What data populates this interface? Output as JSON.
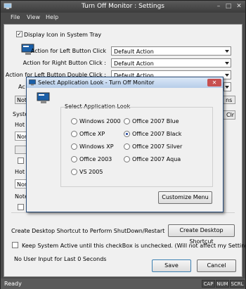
{
  "window": {
    "title": "Turn Off Monitor : Settings"
  },
  "menu": {
    "items": [
      "File",
      "View",
      "Help"
    ]
  },
  "settings": {
    "display_tray_label": "Display Icon in System Tray",
    "display_tray_checked": true,
    "left_click_label": "Action for Left Button Click",
    "left_click_value": "Default Action",
    "right_click_label": "Action for Right Button Click :",
    "right_click_value": "Default Action",
    "left_dbl_label": "Action for Left Button Double Click :",
    "left_dbl_value": "Default Action",
    "partial_act": "Ac",
    "partial_note1": "Note",
    "partial_syste": "Syste",
    "partial_hot1": "Hot k",
    "partial_none1": "Non",
    "partial_hot2": "Hot k",
    "partial_none2": "Non",
    "partial_note2": "Note",
    "partial_ns": "ns",
    "partial_clr": "Clr",
    "shortcut_label": "Create Desktop Shortcut to Perform ShutDown/Restart",
    "shortcut_button": "Create Desktop Shortcut",
    "keep_active_label": "Keep System Active until this checkBox is unchecked.  (Will not affect my Settings)",
    "keep_active_checked": false,
    "no_input_label": "No User Input for Last 0 Seconds",
    "save_button": "Save",
    "cancel_button": "Cancel"
  },
  "statusbar": {
    "text": "Ready",
    "indicators": [
      "CAP",
      "NUM",
      "SCRL"
    ]
  },
  "dialog": {
    "title": "Select Application Look - Turn Off Monitor",
    "close_label": "✕",
    "group_label": "Select Application Look",
    "options": [
      {
        "label": "Windows 2000",
        "selected": false
      },
      {
        "label": "Office 2007 Blue",
        "selected": false
      },
      {
        "label": "Office XP",
        "selected": false
      },
      {
        "label": "Office 2007 Black",
        "selected": true
      },
      {
        "label": "Windows XP",
        "selected": false
      },
      {
        "label": "Office 2007 Silver",
        "selected": false
      },
      {
        "label": "Office 2003",
        "selected": false
      },
      {
        "label": "Office 2007 Aqua",
        "selected": false
      },
      {
        "label": "VS 2005",
        "selected": false
      }
    ],
    "customize_button": "Customize Menu"
  },
  "icons": {
    "app": "monitor-icon",
    "close": "close-icon",
    "dropdown": "chevron-down-icon"
  },
  "colors": {
    "title_bar": "#3c3c3c",
    "dialog_title": "#b6cde9",
    "selected_radio": "#1a3f9a"
  }
}
